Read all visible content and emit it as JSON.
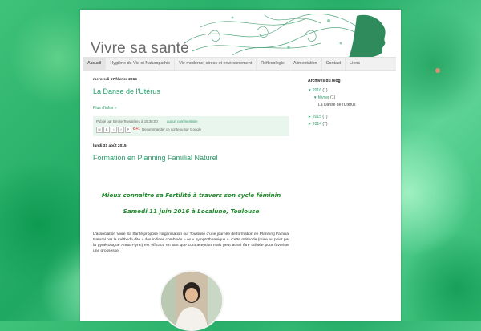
{
  "header": {
    "blog_title": "Vivre sa santé"
  },
  "nav": {
    "tabs": [
      "Accueil",
      "Hygiène de Vie et Naturopathie",
      "Vie moderne, stress et environnement",
      "Réflexologie",
      "Alimentation",
      "Contact",
      "Liens"
    ]
  },
  "posts": [
    {
      "date": "mercredi 17 février 2016",
      "title": "La Danse de l'Utérus",
      "more_link": "Plus d'infos »",
      "posted_by": "Publié par Emilie Teyssières à 15:36:00",
      "comments": "aucun commentaire",
      "share_icons": [
        "M",
        "B",
        "t",
        "f",
        "P"
      ],
      "gplus": "G+1",
      "gplus_text": "Recommander ce contenu sur Google"
    },
    {
      "date": "lundi 31 août 2015",
      "title": "Formation en Planning Familial Naturel",
      "subtitle_1": "Mieux connaitre sa Fertilité à travers son cycle féminin",
      "subtitle_2": "Samedi 11 juin 2016 à Localune, Toulouse",
      "body": "L'association Vivre Sa Santé propose l'organisation sur Toulouse d'une journée de formation en Planning Familial Naturel par la méthode dite « des indices combinés » ou « symptothermique ». Cette méthode (mise au point par la gynécologue Anna Flynn) est efficace en tant que contraception mais peut aussi être utilisée pour favoriser une grossesse."
    }
  ],
  "sidebar": {
    "title": "Archives du blog",
    "archives": [
      {
        "arrow": "▼",
        "label": "2016",
        "count": "(1)"
      },
      {
        "arrow": "▼",
        "label": "février",
        "count": "(1)"
      },
      {
        "label": "La Danse de l'Utérus"
      },
      {
        "arrow": "►",
        "label": "2015",
        "count": "(7)"
      },
      {
        "arrow": "►",
        "label": "2014",
        "count": "(7)"
      }
    ]
  },
  "colors": {
    "accent": "#2a9a69",
    "heading_green": "#1e8a2a",
    "footer_bg": "#e9f6ee"
  }
}
